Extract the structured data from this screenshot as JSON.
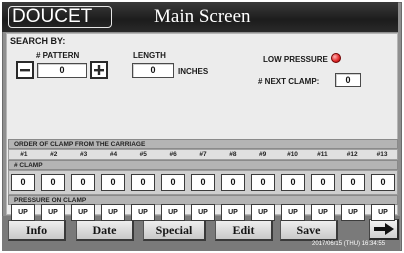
{
  "header": {
    "brand": "DOUCET",
    "title": "Main Screen"
  },
  "search": {
    "label": "SEARCH BY:",
    "pattern_label": "# PATTERN",
    "pattern_value": "0",
    "length_label": "LENGTH",
    "length_value": "0",
    "length_unit": "INCHES"
  },
  "status": {
    "low_pressure_label": "LOW PRESSURE",
    "next_clamp_label": "# NEXT CLAMP:",
    "next_clamp_value": "0",
    "low_pressure_lamp_color": "#e53030"
  },
  "grid": {
    "order_header": "ORDER OF CLAMP FROM THE CARRIAGE",
    "columns": [
      "#1",
      "#2",
      "#3",
      "#4",
      "#5",
      "#6",
      "#7",
      "#8",
      "#9",
      "#10",
      "#11",
      "#12",
      "#13"
    ],
    "clamp_header": "# CLAMP",
    "clamp_values": [
      "0",
      "0",
      "0",
      "0",
      "0",
      "0",
      "0",
      "0",
      "0",
      "0",
      "0",
      "0",
      "0"
    ],
    "pressure_header": "PRESSURE ON CLAMP",
    "pressure_values": [
      "UP",
      "UP",
      "UP",
      "UP",
      "UP",
      "UP",
      "UP",
      "UP",
      "UP",
      "UP",
      "UP",
      "UP",
      "UP"
    ]
  },
  "footer": {
    "buttons": [
      "Info",
      "Date",
      "Special",
      "Edit",
      "Save"
    ],
    "timestamp": "2017/06/15 (THU) 16:34:55",
    "next_icon": "arrow-right-icon"
  }
}
